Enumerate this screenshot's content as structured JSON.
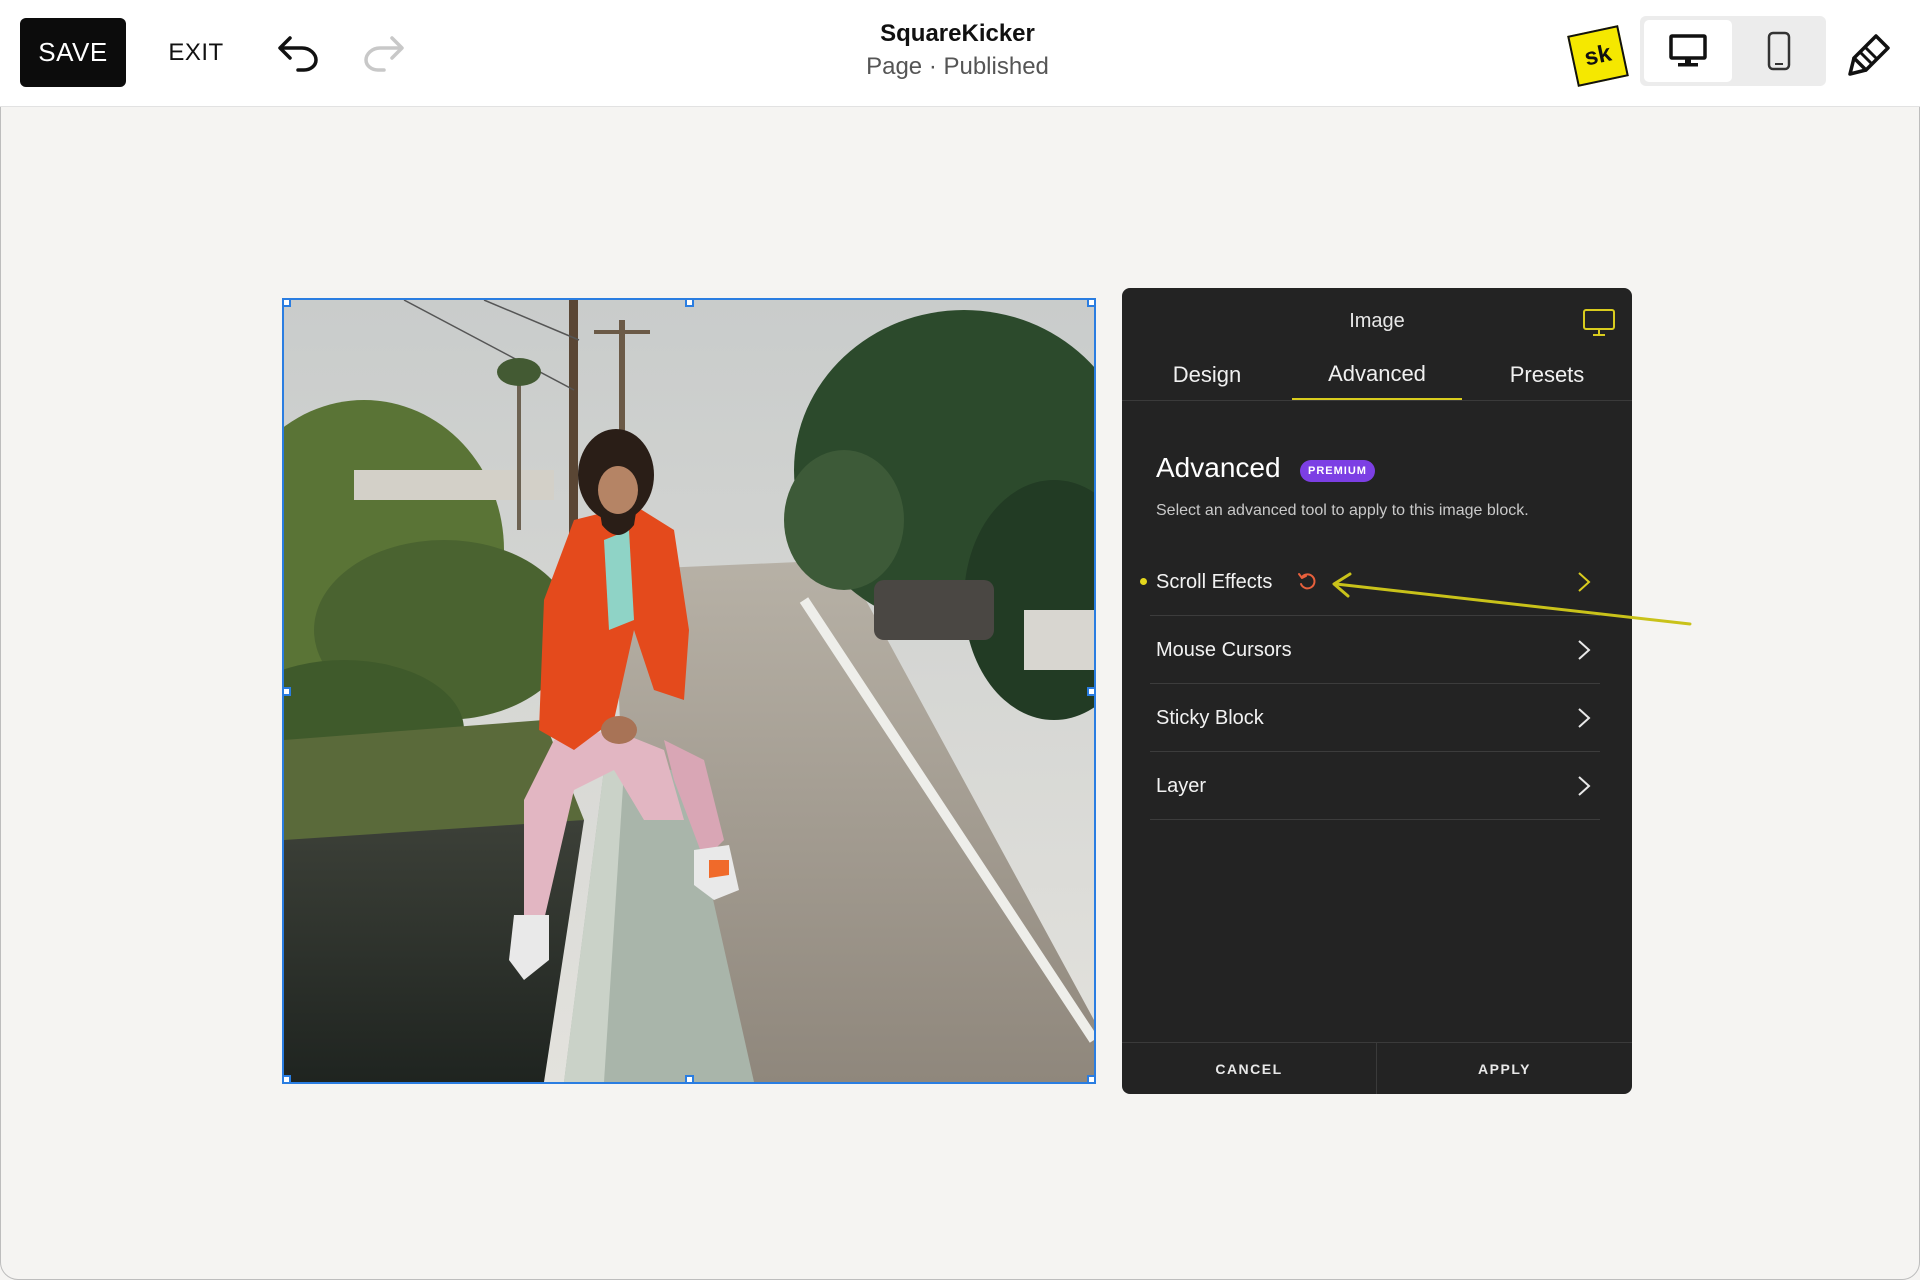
{
  "toolbar": {
    "save_label": "SAVE",
    "exit_label": "EXIT",
    "undo_icon": "undo-icon",
    "redo_icon": "redo-icon"
  },
  "header": {
    "site_title": "SquareKicker",
    "page_status": "Page · Published"
  },
  "brand": {
    "logo_text": "sk",
    "logo_color": "#f5e800"
  },
  "device_toggle": {
    "options": [
      "desktop",
      "mobile"
    ],
    "selected": "desktop"
  },
  "panel": {
    "title": "Image",
    "tabs": [
      {
        "label": "Design",
        "active": false
      },
      {
        "label": "Advanced",
        "active": true
      },
      {
        "label": "Presets",
        "active": false
      }
    ],
    "section_title": "Advanced",
    "badge": "PREMIUM",
    "description": "Select an advanced tool to apply to this image block.",
    "items": [
      {
        "label": "Scroll Effects",
        "active": true
      },
      {
        "label": "Mouse Cursors",
        "active": false
      },
      {
        "label": "Sticky Block",
        "active": false
      },
      {
        "label": "Layer",
        "active": false
      }
    ],
    "footer": {
      "cancel_label": "CANCEL",
      "apply_label": "APPLY"
    }
  },
  "colors": {
    "accent_yellow": "#d9cc1e",
    "selection_blue": "#2a7de1",
    "premium_purple": "#7c3fe4",
    "reset_red": "#e8603c",
    "panel_bg": "#232323"
  }
}
